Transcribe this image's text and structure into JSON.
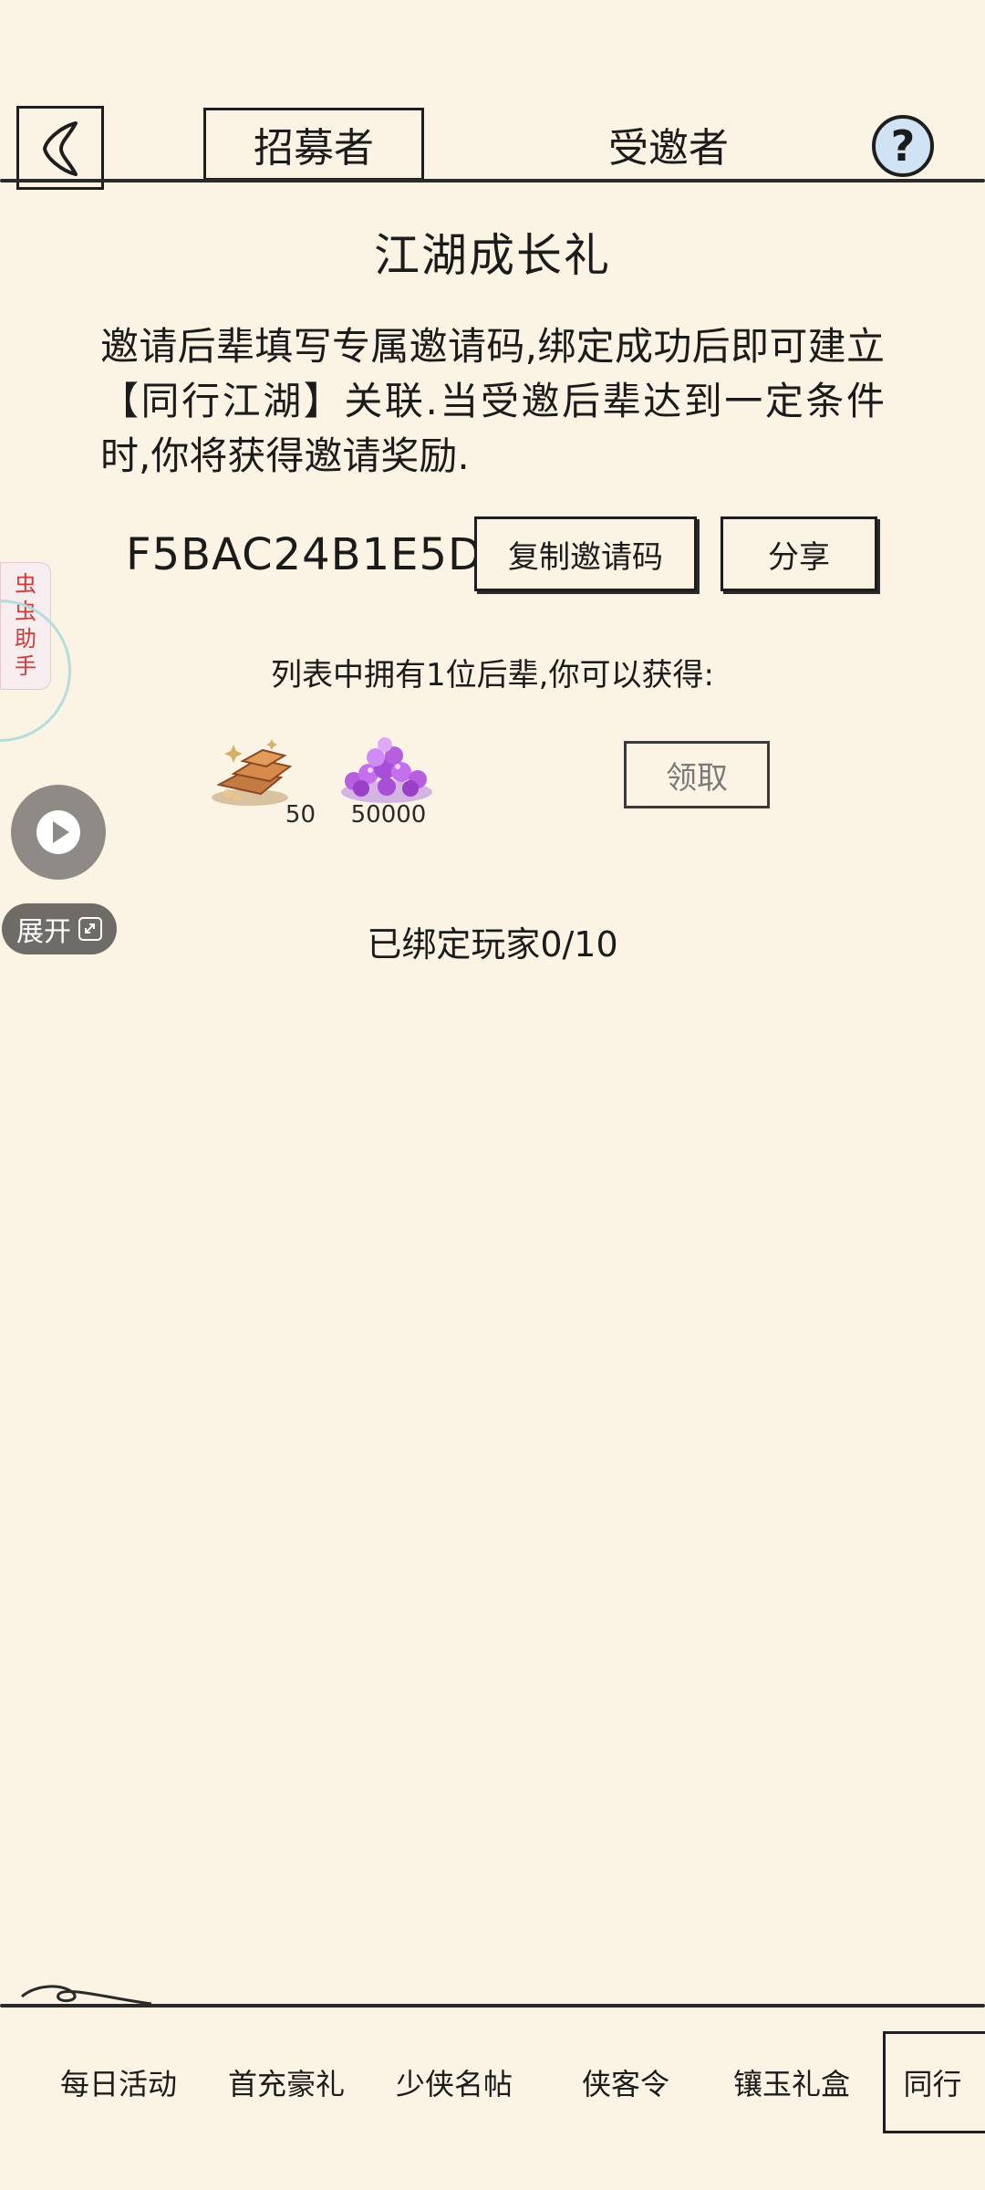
{
  "header": {
    "tabs": [
      {
        "label": "招募者",
        "active": true
      },
      {
        "label": "受邀者",
        "active": false
      }
    ],
    "help_label": "?"
  },
  "panel": {
    "title": "江湖成长礼",
    "description": "邀请后辈填写专属邀请码,绑定成功后即可建立【同行江湖】关联.当受邀后辈达到一定条件时,你将获得邀请奖励.",
    "invite_code": "F5BAC24B1E5D",
    "copy_button": "复制邀请码",
    "share_button": "分享",
    "reward_caption": "列表中拥有1位后辈,你可以获得:",
    "rewards": [
      {
        "icon": "gold-ingots-icon",
        "quantity": "50"
      },
      {
        "icon": "purple-gems-icon",
        "quantity": "50000"
      }
    ],
    "claim_button": "领取",
    "bound_status": "已绑定玩家0/10"
  },
  "overlay": {
    "helper_label": "虫虫助手",
    "expand_label": "展开"
  },
  "bottom_tabs": [
    {
      "label": "每日活动"
    },
    {
      "label": "首充豪礼"
    },
    {
      "label": "少侠名帖"
    },
    {
      "label": "侠客令"
    },
    {
      "label": "镶玉礼盒"
    },
    {
      "label": "同行",
      "active": true
    }
  ],
  "colors": {
    "background": "#fbf4e4",
    "ink": "#1e1e1e",
    "help_button": "#cfe3f5",
    "helper_text": "#d23a3a"
  }
}
